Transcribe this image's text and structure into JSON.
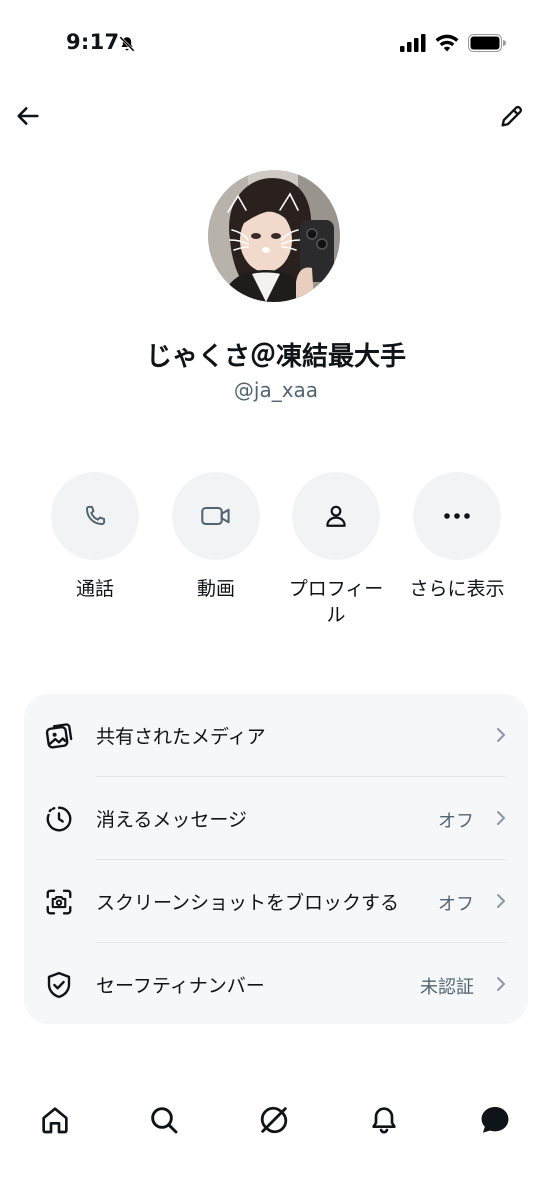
{
  "status_bar": {
    "time": "9:17"
  },
  "profile": {
    "name": "じゃくさ＠凍結最大手",
    "handle": "@ja_xaa"
  },
  "actions": [
    {
      "label": "通話",
      "icon": "phone-icon"
    },
    {
      "label": "動画",
      "icon": "video-icon"
    },
    {
      "label": "プロフィー\nル",
      "icon": "person-icon"
    },
    {
      "label": "さらに表示",
      "icon": "more-icon"
    }
  ],
  "settings": [
    {
      "label": "共有されたメディア",
      "value": "",
      "icon": "media-icon"
    },
    {
      "label": "消えるメッセージ",
      "value": "オフ",
      "icon": "timer-icon"
    },
    {
      "label": "スクリーンショットをブロックする",
      "value": "オフ",
      "icon": "screenshot-icon"
    },
    {
      "label": "セーフティナンバー",
      "value": "未認証",
      "icon": "shield-check-icon"
    }
  ],
  "tabs": [
    {
      "name": "home",
      "icon": "home-icon"
    },
    {
      "name": "search",
      "icon": "search-icon"
    },
    {
      "name": "grok",
      "icon": "grok-icon"
    },
    {
      "name": "notifications",
      "icon": "bell-icon"
    },
    {
      "name": "messages",
      "icon": "chat-bubble-icon"
    }
  ],
  "colors": {
    "text_primary": "#0f1419",
    "text_secondary": "#536471",
    "card_bg": "#f5f7f8",
    "action_circle_bg": "#f1f3f4"
  }
}
